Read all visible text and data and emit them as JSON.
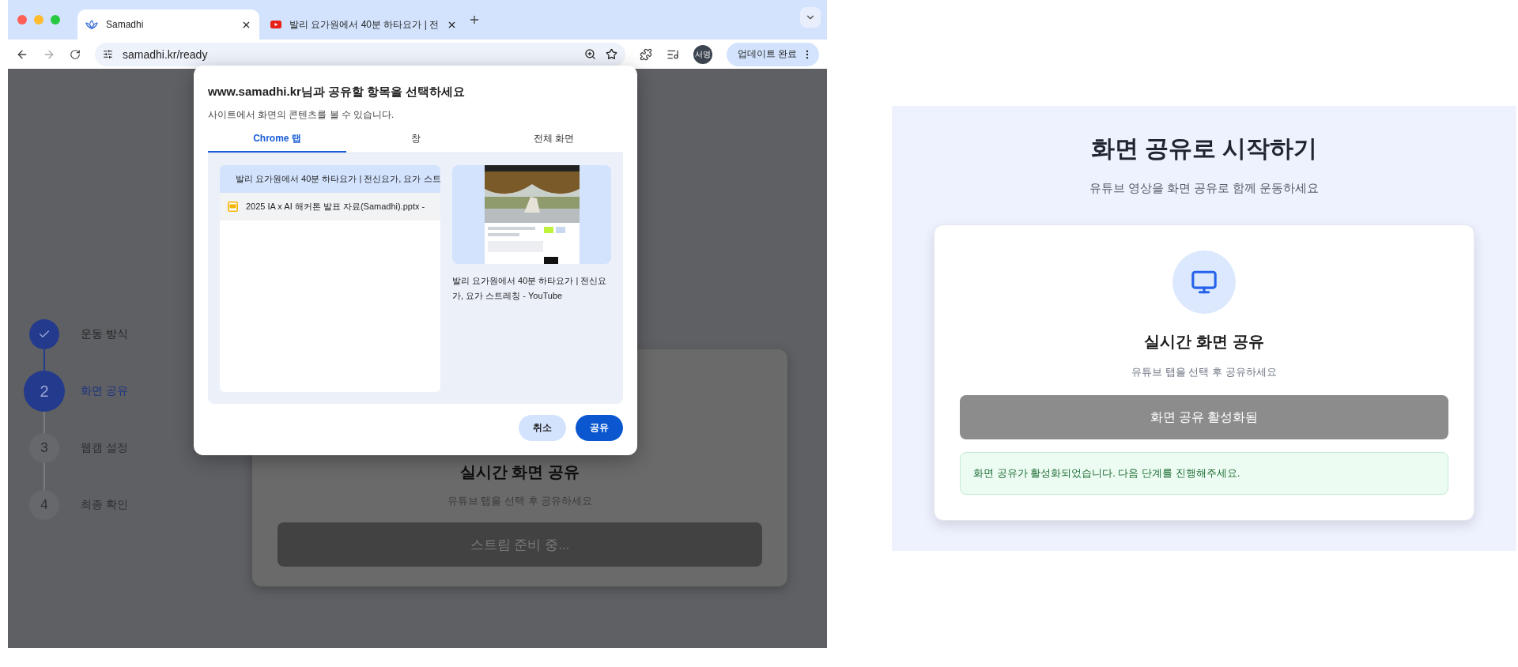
{
  "browser": {
    "tabs": [
      {
        "kind": "site",
        "title": "Samadhi",
        "selected": true
      },
      {
        "kind": "youtube",
        "title": "발리 요가원에서 40분 하타요가 | 전",
        "selected": false
      }
    ],
    "address": "samadhi.kr/ready",
    "profile": "서영",
    "update_button": "업데이트 완료"
  },
  "steps": [
    {
      "completed": true,
      "selected": false,
      "label": "운동 방식"
    },
    {
      "completed": false,
      "selected": true,
      "number": "2",
      "label": "화면 공유"
    },
    {
      "completed": false,
      "selected": false,
      "number": "3",
      "label": "웹캠 설정"
    },
    {
      "completed": false,
      "selected": false,
      "number": "4",
      "label": "최종 확인"
    }
  ],
  "background_card": {
    "title": "실시간 화면 공유",
    "subtitle": "유튜브 탭을 선택 후 공유하세요",
    "button": "스트림 준비 중..."
  },
  "share_dialog": {
    "title": "www.samadhi.kr님과 공유할 항목을 선택하세요",
    "subtitle": "사이트에서 화면의 콘텐츠를 볼 수 있습니다.",
    "tabs": [
      {
        "label": "Chrome 탭",
        "selected": true
      },
      {
        "label": "창",
        "selected": false
      },
      {
        "label": "전체 화면",
        "selected": false
      }
    ],
    "sources": [
      {
        "kind": "youtube",
        "title": "발리 요가원에서 40분 하타요가 | 전신요가, 요가 스트",
        "selected": true
      },
      {
        "kind": "slides",
        "title": "2025 IA x AI 해커톤 발표 자료(Samadhi).pptx -",
        "selected": false
      }
    ],
    "preview_caption": "발리 요가원에서 40분 하타요가 | 전신요가, 요가 스트레칭 - YouTube",
    "cancel_button": "취소",
    "share_button": "공유"
  },
  "result_panel": {
    "title": "화면 공유로 시작하기",
    "subtitle": "유튜브 영상을 화면 공유로 함께 운동하세요",
    "card_title": "실시간 화면 공유",
    "card_subtitle": "유튜브 탭을 선택 후 공유하세요",
    "button": {
      "label": "화면 공유 활성화됨",
      "disabled": true
    },
    "alert": "화면 공유가 활성화되었습니다. 다음 단계를 진행해주세요."
  }
}
